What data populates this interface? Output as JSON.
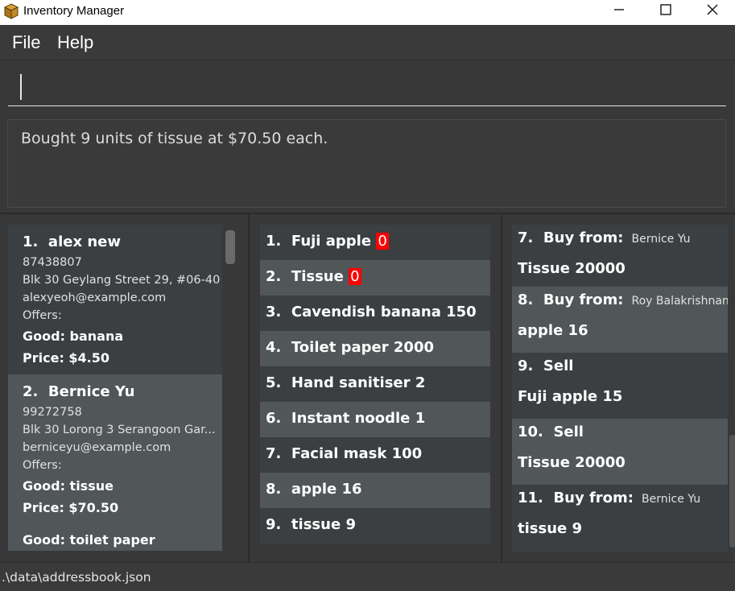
{
  "window": {
    "title": "Inventory Manager",
    "minimize_icon": "minimize-icon",
    "maximize_icon": "maximize-icon",
    "close_icon": "close-icon"
  },
  "menu": {
    "file": "File",
    "help": "Help"
  },
  "command": {
    "value": ""
  },
  "result": {
    "message": "Bought 9 units of tissue at $70.50 each."
  },
  "persons": [
    {
      "index": "1.",
      "name": "alex new",
      "phone": "87438807",
      "address": "Blk 30 Geylang Street 29, #06-40",
      "email": "alexyeoh@example.com",
      "offers_label": "Offers:",
      "offers": [
        {
          "good": "Good: banana",
          "price": "Price: $4.50"
        }
      ]
    },
    {
      "index": "2.",
      "name": "Bernice Yu",
      "phone": "99272758",
      "address": "Blk 30 Lorong 3 Serangoon Gar...",
      "email": "berniceyu@example.com",
      "offers_label": "Offers:",
      "offers": [
        {
          "good": "Good: tissue",
          "price": "Price: $70.50"
        },
        {
          "good": "Good: toilet paper",
          "price": ""
        }
      ]
    }
  ],
  "inventory": [
    {
      "index": "1.",
      "name": "Fuji apple",
      "qty": "0",
      "out_of_stock": true
    },
    {
      "index": "2.",
      "name": "Tissue",
      "qty": "0",
      "out_of_stock": true
    },
    {
      "index": "3.",
      "name": "Cavendish banana",
      "qty": "150",
      "out_of_stock": false
    },
    {
      "index": "4.",
      "name": "Toilet paper",
      "qty": "2000",
      "out_of_stock": false
    },
    {
      "index": "5.",
      "name": "Hand sanitiser",
      "qty": "2",
      "out_of_stock": false
    },
    {
      "index": "6.",
      "name": "Instant noodle",
      "qty": "1",
      "out_of_stock": false
    },
    {
      "index": "7.",
      "name": "Facial mask",
      "qty": "100",
      "out_of_stock": false
    },
    {
      "index": "8.",
      "name": "apple",
      "qty": "16",
      "out_of_stock": false
    },
    {
      "index": "9.",
      "name": "tissue",
      "qty": "9",
      "out_of_stock": false
    }
  ],
  "transactions": [
    {
      "index": "7.",
      "type": "Buy from:",
      "party": "Bernice Yu",
      "detail": "Tissue 20000"
    },
    {
      "index": "8.",
      "type": "Buy from:",
      "party": "Roy Balakrishnan",
      "detail": "apple 16"
    },
    {
      "index": "9.",
      "type": "Sell",
      "party": "",
      "detail": "Fuji apple 15"
    },
    {
      "index": "10.",
      "type": "Sell",
      "party": "",
      "detail": "Tissue 20000"
    },
    {
      "index": "11.",
      "type": "Buy from:",
      "party": "Bernice Yu",
      "detail": "tissue 9"
    }
  ],
  "status": {
    "path": ".\\data\\addressbook.json"
  },
  "colors": {
    "background": "#383838",
    "card_alt": "#515658",
    "card_base": "#3c3f41",
    "out_of_stock_badge": "#ff0000"
  }
}
